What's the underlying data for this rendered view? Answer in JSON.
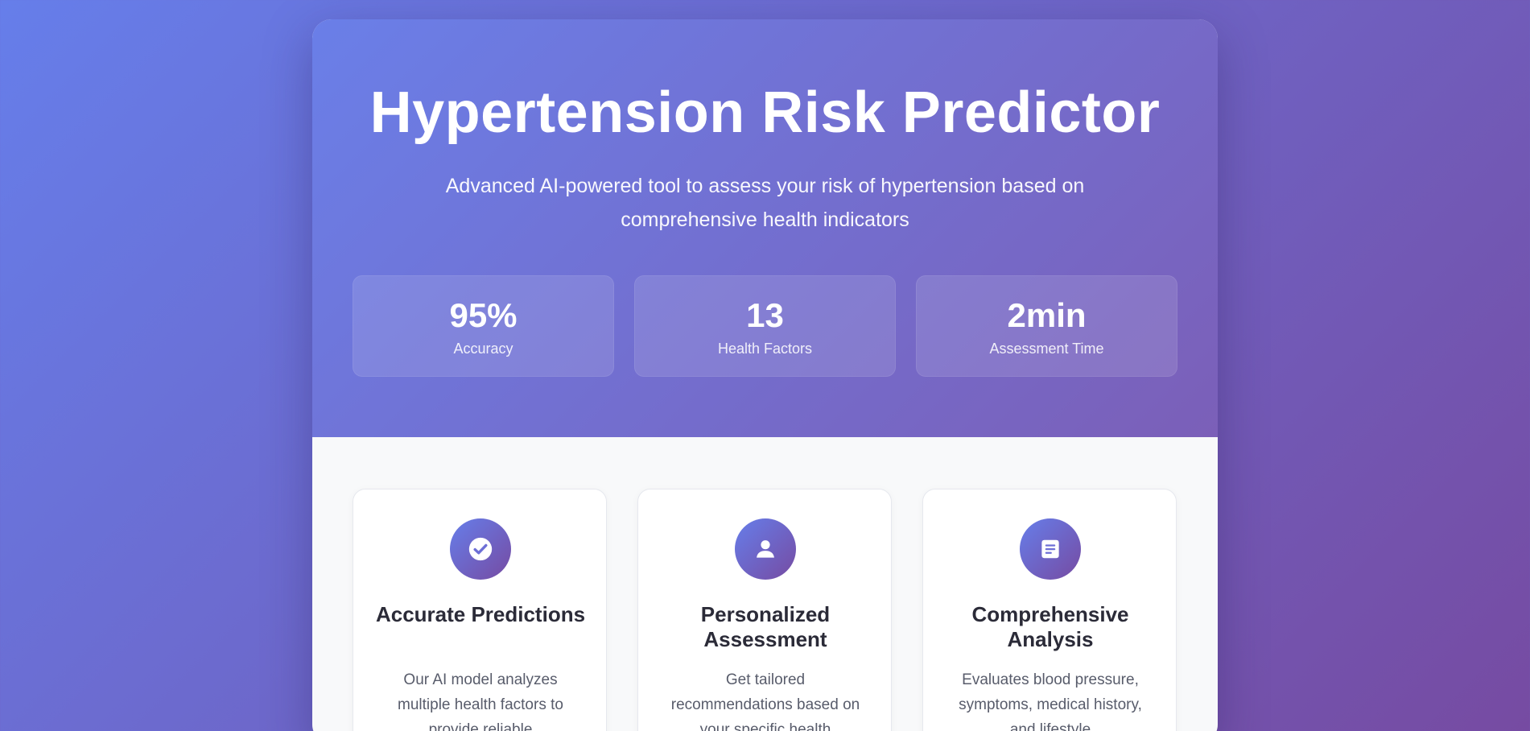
{
  "hero": {
    "title": "Hypertension Risk Predictor",
    "subtitle": "Advanced AI-powered tool to assess your risk of hypertension based on comprehensive health indicators",
    "stats": [
      {
        "value": "95%",
        "label": "Accuracy"
      },
      {
        "value": "13",
        "label": "Health Factors"
      },
      {
        "value": "2min",
        "label": "Assessment Time"
      }
    ]
  },
  "features": [
    {
      "icon": "check-circle-icon",
      "title": "Accurate Predictions",
      "description": "Our AI model analyzes multiple health factors to provide reliable"
    },
    {
      "icon": "person-icon",
      "title": "Personalized Assessment",
      "description": "Get tailored recommendations based on your specific health"
    },
    {
      "icon": "document-icon",
      "title": "Comprehensive Analysis",
      "description": "Evaluates blood pressure, symptoms, medical history, and lifestyle"
    }
  ],
  "colors": {
    "gradient_start": "#667eea",
    "gradient_end": "#764ba2",
    "card_background": "#ffffff",
    "section_background": "#f8f9fa"
  }
}
